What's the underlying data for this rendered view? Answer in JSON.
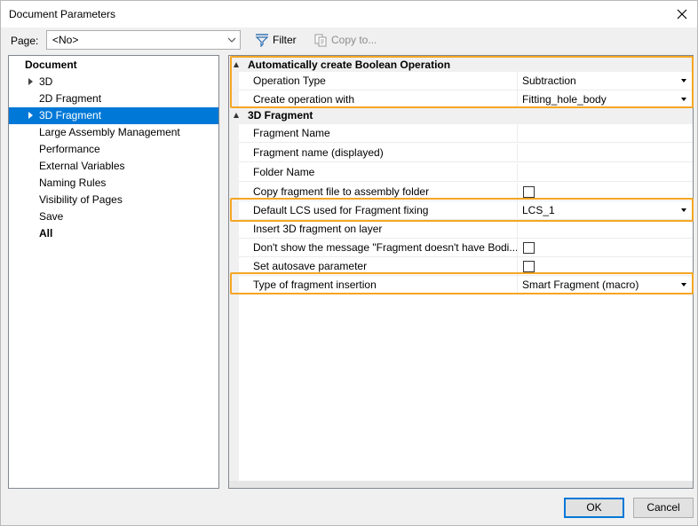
{
  "window": {
    "title": "Document Parameters"
  },
  "toolbar": {
    "page_label": "Page:",
    "page_value": "<No>",
    "filter_label": "Filter",
    "copy_label": "Copy to..."
  },
  "tree": {
    "items": [
      {
        "label": "Document",
        "bold": true
      },
      {
        "label": "3D",
        "expandable": true
      },
      {
        "label": "2D Fragment"
      },
      {
        "label": "3D Fragment",
        "expandable": true,
        "selected": true
      },
      {
        "label": "Large Assembly Management"
      },
      {
        "label": "Performance"
      },
      {
        "label": "External Variables"
      },
      {
        "label": "Naming Rules"
      },
      {
        "label": "Visibility of Pages"
      },
      {
        "label": "Save"
      },
      {
        "label": "All",
        "bold": true
      }
    ]
  },
  "properties": {
    "cat_boolean": "Automatically create Boolean Operation",
    "op_type_name": "Operation Type",
    "op_type_value": "Subtraction",
    "create_with_name": "Create operation with",
    "create_with_value": "Fitting_hole_body",
    "cat_fragment": "3D Fragment",
    "frag_name": "Fragment Name",
    "frag_name_displayed": "Fragment name (displayed)",
    "folder_name": "Folder Name",
    "copy_frag": "Copy fragment file to assembly folder",
    "lcs_name": "Default LCS used for Fragment fixing",
    "lcs_value": "LCS_1",
    "insert_layer": "Insert 3D fragment on layer",
    "dont_show": "Don't show the message \"Fragment doesn't have Bodi...",
    "autosave": "Set autosave parameter",
    "insertion_type_name": "Type of fragment insertion",
    "insertion_type_value": "Smart Fragment (macro)"
  },
  "buttons": {
    "ok": "OK",
    "cancel": "Cancel"
  },
  "colors": {
    "accent": "#0078d7",
    "highlight": "#f5a623"
  }
}
